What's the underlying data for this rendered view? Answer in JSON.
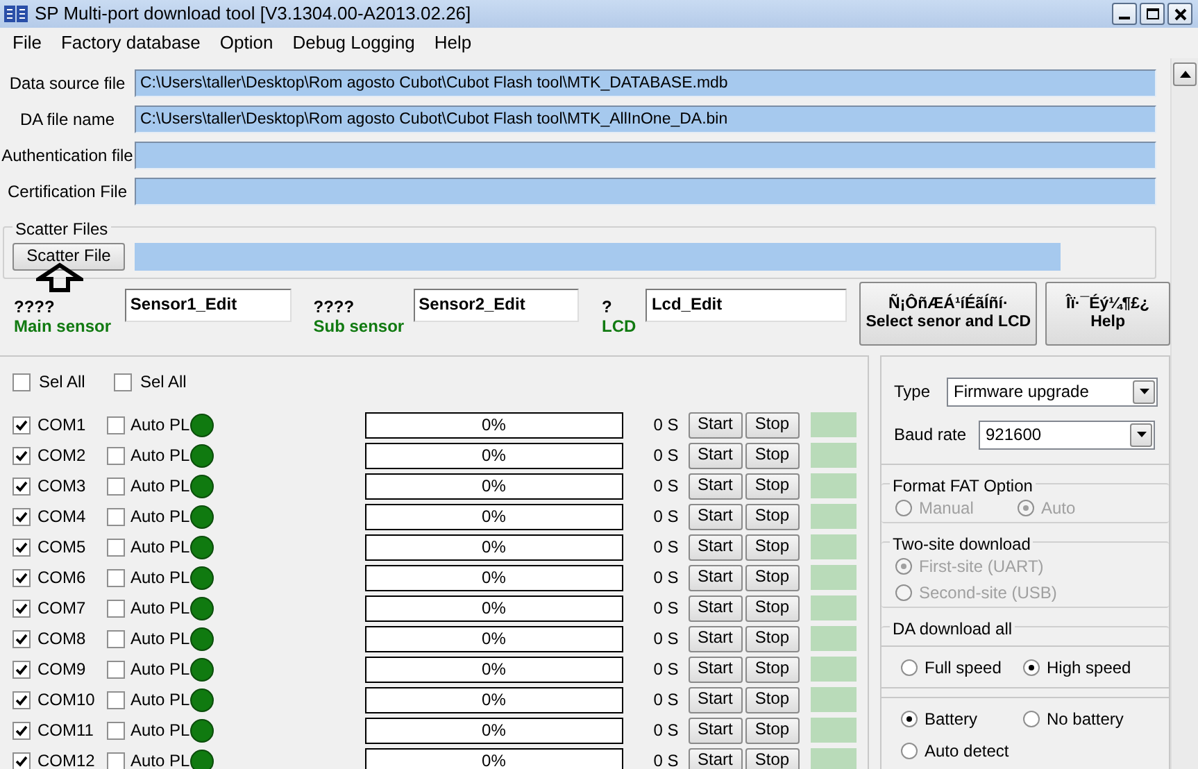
{
  "window": {
    "title": "SP Multi-port download tool [V3.1304.00-A2013.02.26]"
  },
  "menu": [
    "File",
    "Factory database",
    "Option",
    "Debug Logging",
    "Help"
  ],
  "file_fields": [
    {
      "label": "Data source file",
      "value": "C:\\Users\\taller\\Desktop\\Rom agosto Cubot\\Cubot Flash tool\\MTK_DATABASE.mdb"
    },
    {
      "label": "DA file name",
      "value": "C:\\Users\\taller\\Desktop\\Rom agosto Cubot\\Cubot Flash tool\\MTK_AllInOne_DA.bin"
    },
    {
      "label": "Authentication file"
    },
    {
      "label": "Certification File"
    }
  ],
  "scatter": {
    "title": "Scatter Files",
    "button": "Scatter File"
  },
  "sensors": [
    {
      "code": "????",
      "label": "Main sensor",
      "value": "Sensor1_Edit"
    },
    {
      "code": "????",
      "label": "Sub sensor",
      "value": "Sensor2_Edit"
    },
    {
      "code": "?",
      "label": "LCD",
      "value": "Lcd_Edit"
    }
  ],
  "action_buttons": [
    {
      "lines": [
        "Ñ¡ÔñÆÁ¹íÉãÍñí·",
        "Select senor and LCD"
      ]
    },
    {
      "lines": [
        "Îï·¯Éý¼¶£¿",
        "Help"
      ]
    }
  ],
  "sel_all": [
    {
      "label": "Sel All",
      "checked": false
    },
    {
      "label": "Sel All",
      "checked": false
    }
  ],
  "ports": [
    {
      "name": "COM1",
      "checked": true,
      "auto_label": "Auto PL",
      "auto_checked": false,
      "level": 0,
      "progress": "0%",
      "time": "0 S",
      "start": "Start",
      "stop": "Stop"
    },
    {
      "name": "COM2",
      "checked": true,
      "auto_label": "Auto PL",
      "auto_checked": false,
      "level": 0,
      "progress": "0%",
      "time": "0 S",
      "start": "Start",
      "stop": "Stop"
    },
    {
      "name": "COM3",
      "checked": true,
      "auto_label": "Auto PL",
      "auto_checked": false,
      "level": 0,
      "progress": "0%",
      "time": "0 S",
      "start": "Start",
      "stop": "Stop"
    },
    {
      "name": "COM4",
      "checked": true,
      "auto_label": "Auto PL",
      "auto_checked": false,
      "level": 0,
      "progress": "0%",
      "time": "0 S",
      "start": "Start",
      "stop": "Stop"
    },
    {
      "name": "COM5",
      "checked": true,
      "auto_label": "Auto PL",
      "auto_checked": false,
      "level": 0,
      "progress": "0%",
      "time": "0 S",
      "start": "Start",
      "stop": "Stop"
    },
    {
      "name": "COM6",
      "checked": true,
      "auto_label": "Auto PL",
      "auto_checked": false,
      "level": 0,
      "progress": "0%",
      "time": "0 S",
      "start": "Start",
      "stop": "Stop"
    },
    {
      "name": "COM7",
      "checked": true,
      "auto_label": "Auto PL",
      "auto_checked": false,
      "level": 0,
      "progress": "0%",
      "time": "0 S",
      "start": "Start",
      "stop": "Stop"
    },
    {
      "name": "COM8",
      "checked": true,
      "auto_label": "Auto PL",
      "auto_checked": false,
      "level": 0,
      "progress": "0%",
      "time": "0 S",
      "start": "Start",
      "stop": "Stop"
    },
    {
      "name": "COM9",
      "checked": true,
      "auto_label": "Auto PL",
      "auto_checked": false,
      "level": 0,
      "progress": "0%",
      "time": "0 S",
      "start": "Start",
      "stop": "Stop"
    },
    {
      "name": "COM10",
      "checked": true,
      "auto_label": "Auto PL",
      "auto_checked": false,
      "level": 0,
      "progress": "0%",
      "time": "0 S",
      "start": "Start",
      "stop": "Stop"
    },
    {
      "name": "COM11",
      "checked": true,
      "auto_label": "Auto PL",
      "auto_checked": false,
      "level": 0,
      "progress": "0%",
      "time": "0 S",
      "start": "Start",
      "stop": "Stop"
    },
    {
      "name": "COM12",
      "checked": true,
      "auto_label": "Auto PL",
      "auto_checked": false,
      "level": 0,
      "progress": "0%",
      "time": "0 S",
      "start": "Start",
      "stop": "Stop"
    }
  ],
  "settings": {
    "type": {
      "label": "Type",
      "value": "Firmware upgrade"
    },
    "baud": {
      "label": "Baud rate",
      "value": "921600"
    },
    "groups": [
      {
        "title": "Format FAT Option",
        "sets": [
          {
            "kind": "row",
            "options": [
              {
                "label": "Manual",
                "selected": false,
                "disabled": true
              },
              {
                "label": "Auto",
                "selected": true,
                "disabled": true
              }
            ]
          }
        ]
      },
      {
        "title": "Two-site download",
        "sets": [
          {
            "kind": "column",
            "options": [
              {
                "label": "First-site (UART)",
                "selected": true,
                "disabled": true
              },
              {
                "label": "Second-site (USB)",
                "selected": false,
                "disabled": true
              }
            ]
          }
        ]
      },
      {
        "title": "DA download all",
        "sets": [
          {
            "kind": "row",
            "options": [
              {
                "label": "Full speed",
                "selected": false,
                "disabled": false
              },
              {
                "label": "High speed",
                "selected": true,
                "disabled": false
              }
            ]
          },
          {
            "kind": "grid",
            "options": [
              {
                "label": "Battery",
                "selected": true,
                "disabled": false
              },
              {
                "label": "No battery",
                "selected": false,
                "disabled": false
              },
              {
                "label": "Auto detect",
                "selected": false,
                "disabled": false
              }
            ]
          }
        ]
      }
    ]
  }
}
